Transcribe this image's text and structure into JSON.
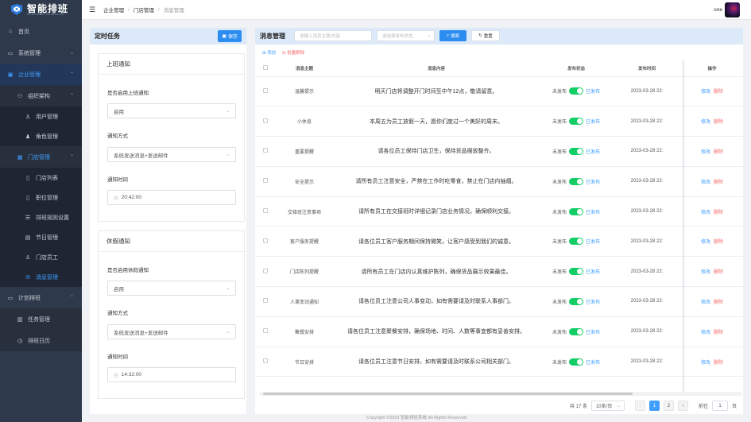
{
  "app": {
    "logo_cn": "智能排班",
    "logo_en": "INTELLIGENT SCHEDULING"
  },
  "sidebar": {
    "home": "首页",
    "system": "系统管理",
    "enterprise": "企业管理",
    "org": "组织架构",
    "user_mgmt": "用户管理",
    "role_mgmt": "角色管理",
    "store_mgmt": "门店管理",
    "store_list": "门店列表",
    "post_mgmt": "职位管理",
    "rules": "排班规则设置",
    "holiday": "节日管理",
    "staff": "门店员工",
    "message": "消息管理",
    "plan": "计划排班",
    "tasks": "任务管理",
    "calendar": "排班日历"
  },
  "header": {
    "breadcrumb": [
      "企业管理",
      "门店管理",
      "消息管理"
    ],
    "user": "one"
  },
  "scheduled": {
    "title": "定时任务",
    "save": "保存",
    "work": {
      "title": "上班通知",
      "enable_label": "是否启用上班通知",
      "enable_value": "启用",
      "method_label": "通知方式",
      "method_value": "系统发送消息+发送邮件",
      "time_label": "通知时间",
      "time_value": "20:42:00"
    },
    "leave": {
      "title": "休假通知",
      "enable_label": "是否启用休假通知",
      "enable_value": "启用",
      "method_label": "通知方式",
      "method_value": "系统发送消息+发送邮件",
      "time_label": "通知时间",
      "time_value": "14:32:00"
    }
  },
  "messages": {
    "title": "消息管理",
    "search_placeholder": "请输入消息主题/内容",
    "status_placeholder": "请选择发布状态",
    "search_btn": "搜索",
    "reset_btn": "重置",
    "add": "添加",
    "batch_delete": "批量删除",
    "columns": [
      "消息主题",
      "消息内容",
      "发布状态",
      "发布时间",
      "操作"
    ],
    "unpublished": "未发布",
    "published": "已发布",
    "edit": "修改",
    "delete": "删除",
    "rows": [
      {
        "subject": "温馨提示",
        "content": "明天门店将调整开门时间至中午12点，敬请留意。",
        "time": "2023-03-28 22:"
      },
      {
        "subject": "小休息",
        "content": "本周五为员工放假一天，愿你们度过一个美好的周末。",
        "time": "2023-03-28 22:"
      },
      {
        "subject": "重要提醒",
        "content": "请各位员工保持门店卫生，保持货品摆放整齐。",
        "time": "2023-03-28 22:"
      },
      {
        "subject": "安全提示",
        "content": "请所有员工注意安全，严禁在工作时吃零食，禁止在门店内抽烟。",
        "time": "2023-03-28 22:"
      },
      {
        "subject": "交接班注意事项",
        "content": "请所有员工在交接班时详细记录门店业务情况，确保顺利交接。",
        "time": "2023-03-28 22:"
      },
      {
        "subject": "客户服务提醒",
        "content": "请各位员工客户服务期间保持微笑，让客户感受到我们的诚意。",
        "time": "2023-03-28 22:"
      },
      {
        "subject": "门店陈列提醒",
        "content": "请所有员工在门店内认真维护陈列，确保货品展示效果最佳。",
        "time": "2023-03-28 22:"
      },
      {
        "subject": "人事变动通知",
        "content": "请各位员工注意公司人事变动，如有需要请及时联系人事部门。",
        "time": "2023-03-28 22:"
      },
      {
        "subject": "聚餐安排",
        "content": "请各位员工注意聚餐安排，确保场地、时间、人数等事宜都有妥善安排。",
        "time": "2023-03-28 22:"
      },
      {
        "subject": "节日安排",
        "content": "请各位员工注意节日安排，如有需要请及时联系公司相关部门。",
        "time": "2023-03-28 22:"
      }
    ],
    "pagination": {
      "total": "共 17 条",
      "page_size": "10条/页",
      "pages": [
        "1",
        "2"
      ],
      "goto_label": "前往",
      "goto_value": "1",
      "goto_suffix": "页"
    }
  },
  "footer": "Copyright ©2023 智能排班系统 All Rights Reserved"
}
